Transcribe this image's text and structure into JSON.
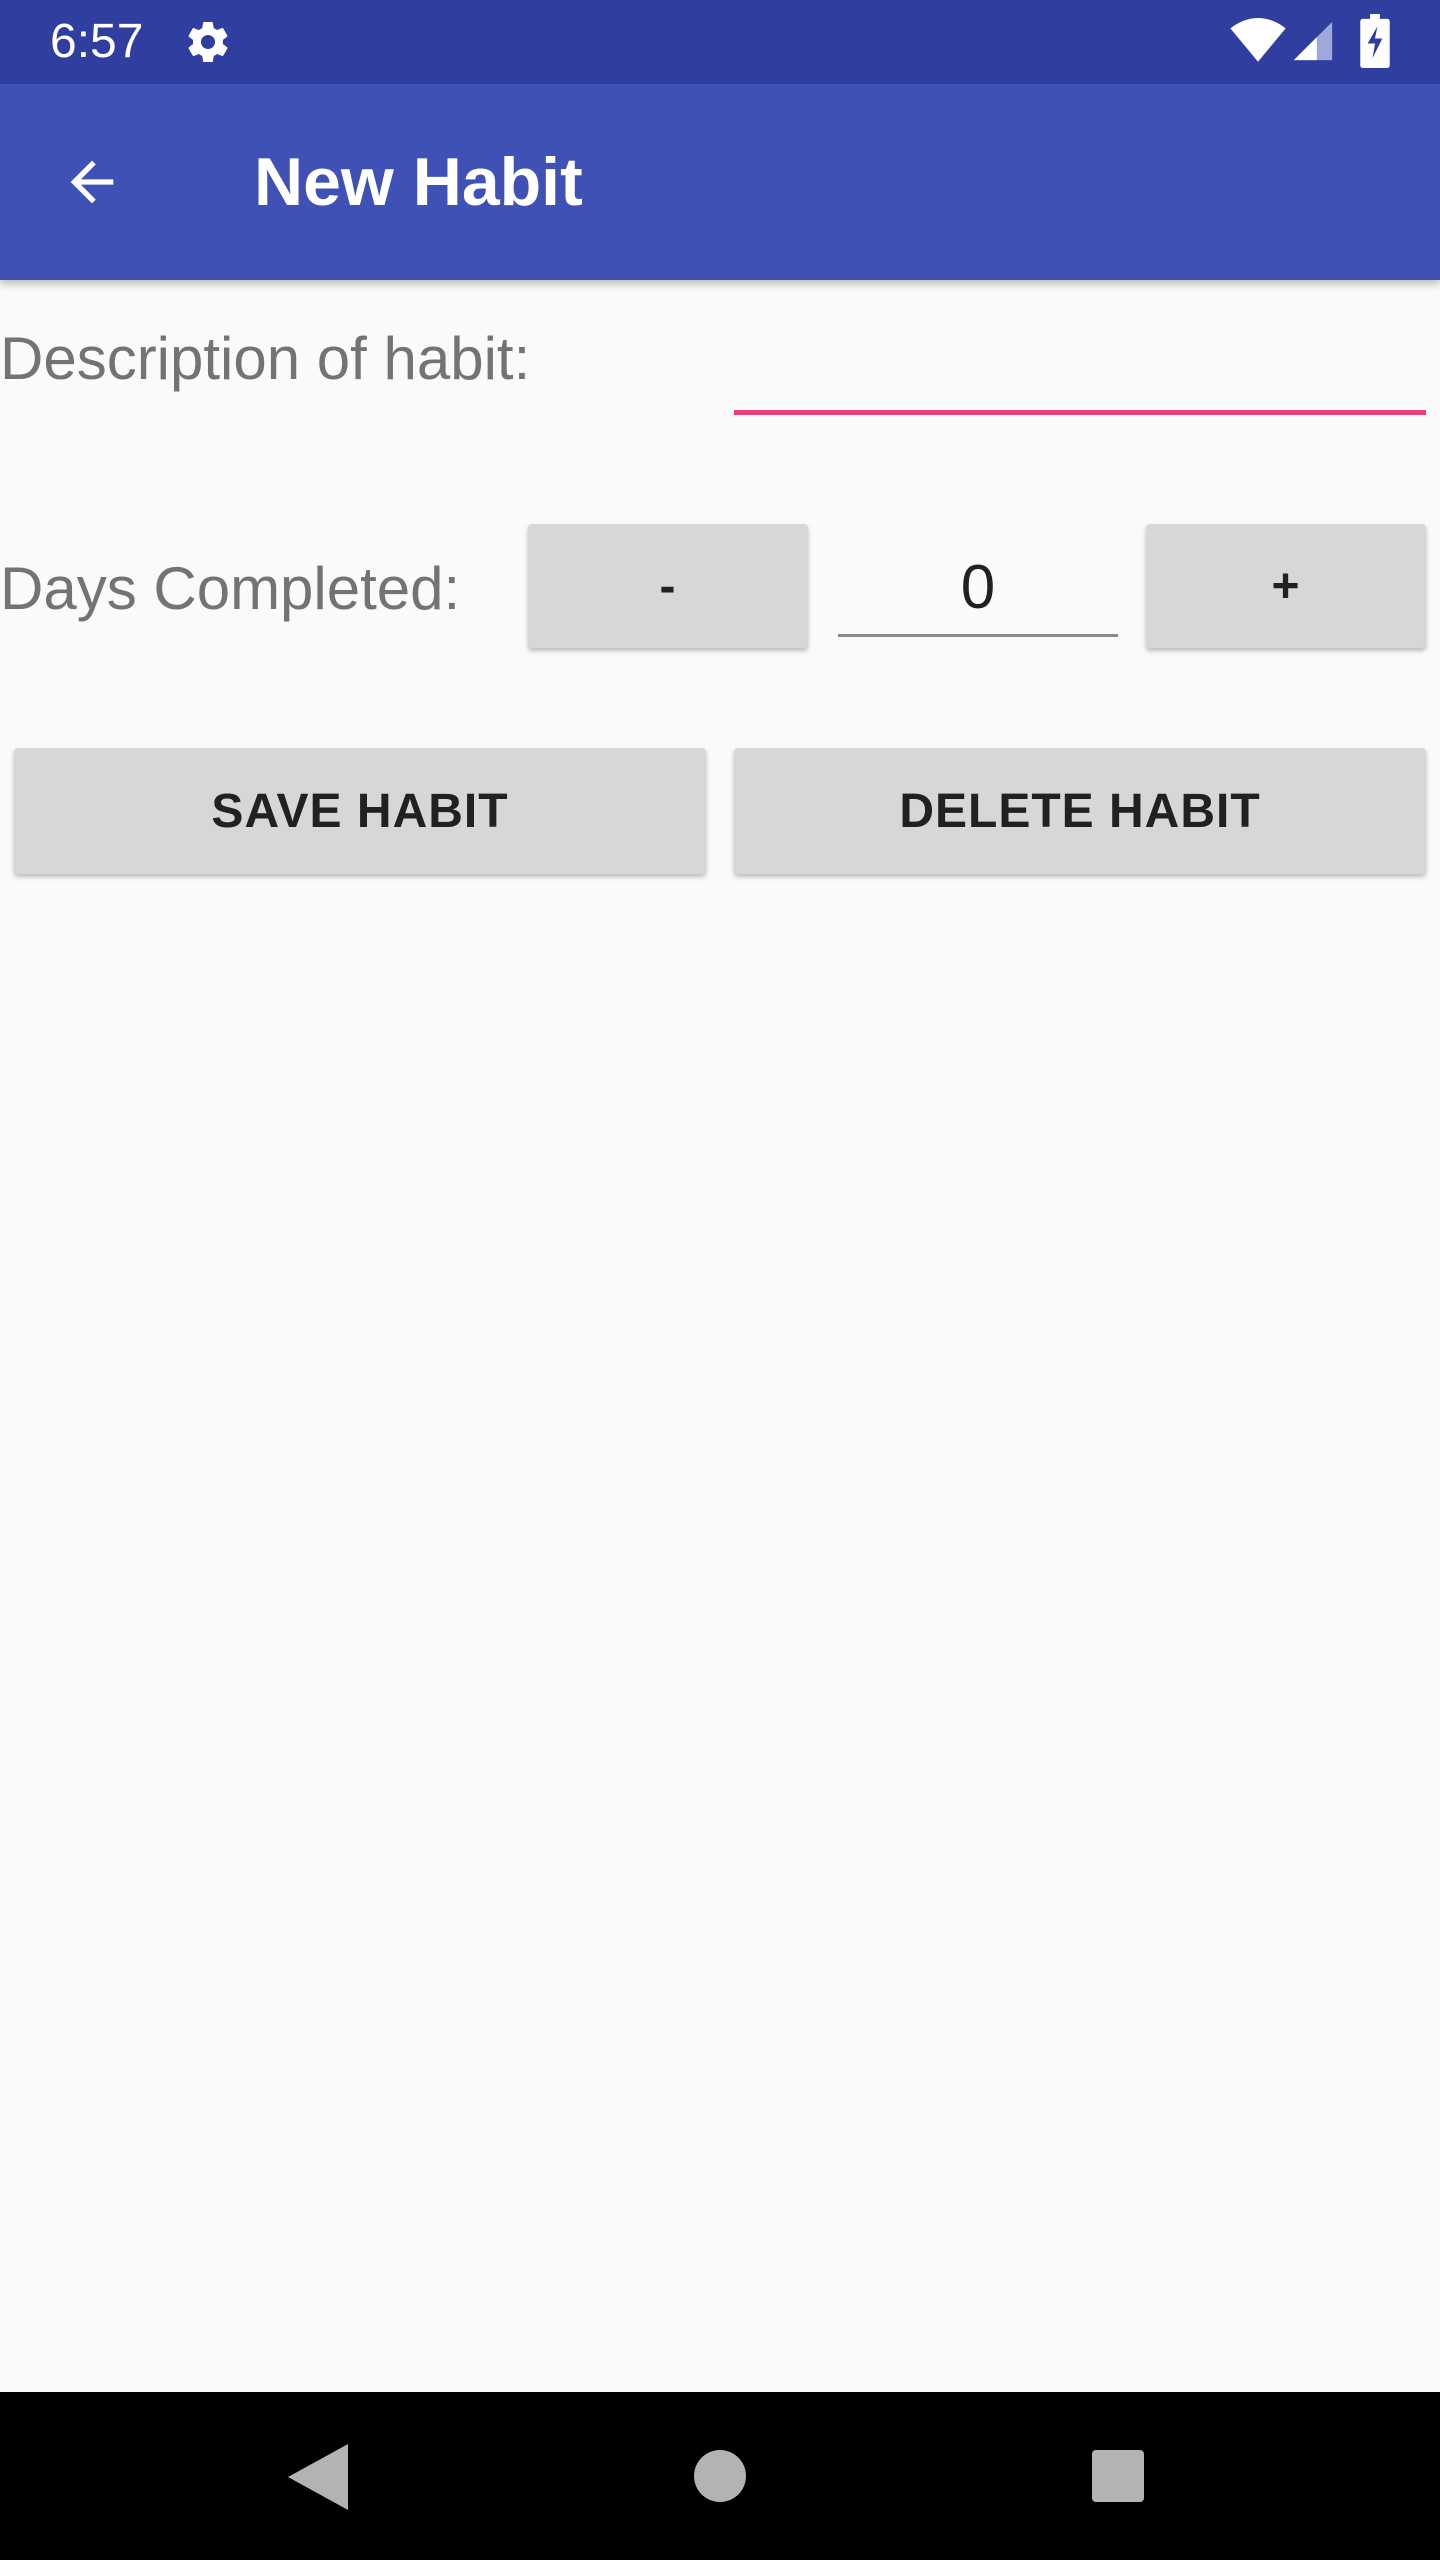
{
  "status_bar": {
    "time": "6:57",
    "icons": [
      "gear-icon",
      "wifi-icon",
      "signal-icon",
      "battery-charging-icon"
    ],
    "background": "#303f9f"
  },
  "app_bar": {
    "title": "New Habit",
    "back_icon": "arrow-back-icon",
    "background": "#3f51b5"
  },
  "form": {
    "description_label": "Description of habit:",
    "description_value": "",
    "description_underline_color": "#ec407a",
    "days_label": "Days Completed:",
    "minus_label": "-",
    "days_value": "0",
    "plus_label": "+"
  },
  "actions": {
    "save_label": "SAVE HABIT",
    "delete_label": "DELETE HABIT"
  },
  "nav_bar": {
    "icons": [
      "nav-back-icon",
      "nav-home-icon",
      "nav-recents-icon"
    ]
  }
}
